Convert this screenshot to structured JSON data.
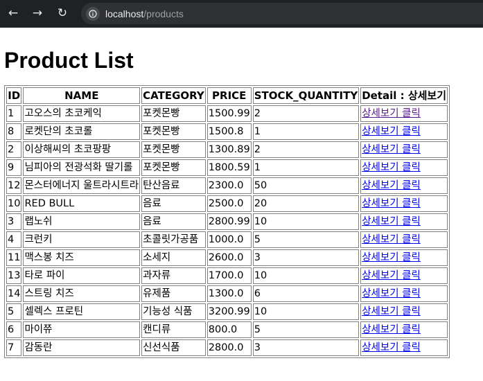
{
  "browser": {
    "url_host": "localhost",
    "url_path": "/products"
  },
  "page": {
    "title": "Product List"
  },
  "table": {
    "headers": [
      "ID",
      "NAME",
      "CATEGORY",
      "PRICE",
      "STOCK_QUANTITY",
      "Detail : 상세보기"
    ],
    "link_label": "상세보기 클릭",
    "rows": [
      {
        "id": "1",
        "name": "고오스의 초코케익",
        "category": "포켓몬빵",
        "price": "1500.99",
        "stock": "2"
      },
      {
        "id": "8",
        "name": "로켓단의 초코롤",
        "category": "포켓몬빵",
        "price": "1500.8",
        "stock": "1"
      },
      {
        "id": "2",
        "name": "이상해씨의 초코팡팡",
        "category": "포켓몬빵",
        "price": "1300.89",
        "stock": "2"
      },
      {
        "id": "9",
        "name": "님피아의 전광석화 딸기롤",
        "category": "포켓몬빵",
        "price": "1800.59",
        "stock": "1"
      },
      {
        "id": "12",
        "name": "몬스터에너지 울트라시트라",
        "category": "탄산음료",
        "price": "2300.0",
        "stock": "50"
      },
      {
        "id": "10",
        "name": "RED BULL",
        "category": "음료",
        "price": "2500.0",
        "stock": "20"
      },
      {
        "id": "3",
        "name": "랩노쉬",
        "category": "음료",
        "price": "2800.99",
        "stock": "10"
      },
      {
        "id": "4",
        "name": "크런키",
        "category": "초콜릿가공품",
        "price": "1000.0",
        "stock": "5"
      },
      {
        "id": "11",
        "name": "맥스봉 치즈",
        "category": "소세지",
        "price": "2600.0",
        "stock": "3"
      },
      {
        "id": "13",
        "name": "타로 파이",
        "category": "과자류",
        "price": "1700.0",
        "stock": "10"
      },
      {
        "id": "14",
        "name": "스트링 치즈",
        "category": "유제품",
        "price": "1300.0",
        "stock": "6"
      },
      {
        "id": "5",
        "name": "셀렉스 프로틴",
        "category": "기능성 식품",
        "price": "3200.99",
        "stock": "10"
      },
      {
        "id": "6",
        "name": "마이쮸",
        "category": "캔디류",
        "price": "800.0",
        "stock": "5"
      },
      {
        "id": "7",
        "name": "감동란",
        "category": "신선식품",
        "price": "2800.0",
        "stock": "3"
      }
    ]
  }
}
